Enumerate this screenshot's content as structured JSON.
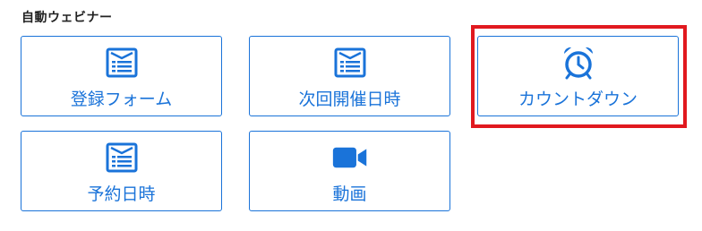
{
  "section": {
    "title": "自動ウェビナー"
  },
  "colors": {
    "accent": "#1a73d9",
    "highlight": "#e1191f",
    "text": "#222222"
  },
  "cards": [
    {
      "label": "登録フォーム",
      "icon": "form-icon"
    },
    {
      "label": "次回開催日時",
      "icon": "form-icon"
    },
    {
      "label": "カウントダウン",
      "icon": "alarm-clock-icon"
    },
    {
      "label": "予約日時",
      "icon": "form-icon"
    },
    {
      "label": "動画",
      "icon": "video-camera-icon"
    }
  ]
}
